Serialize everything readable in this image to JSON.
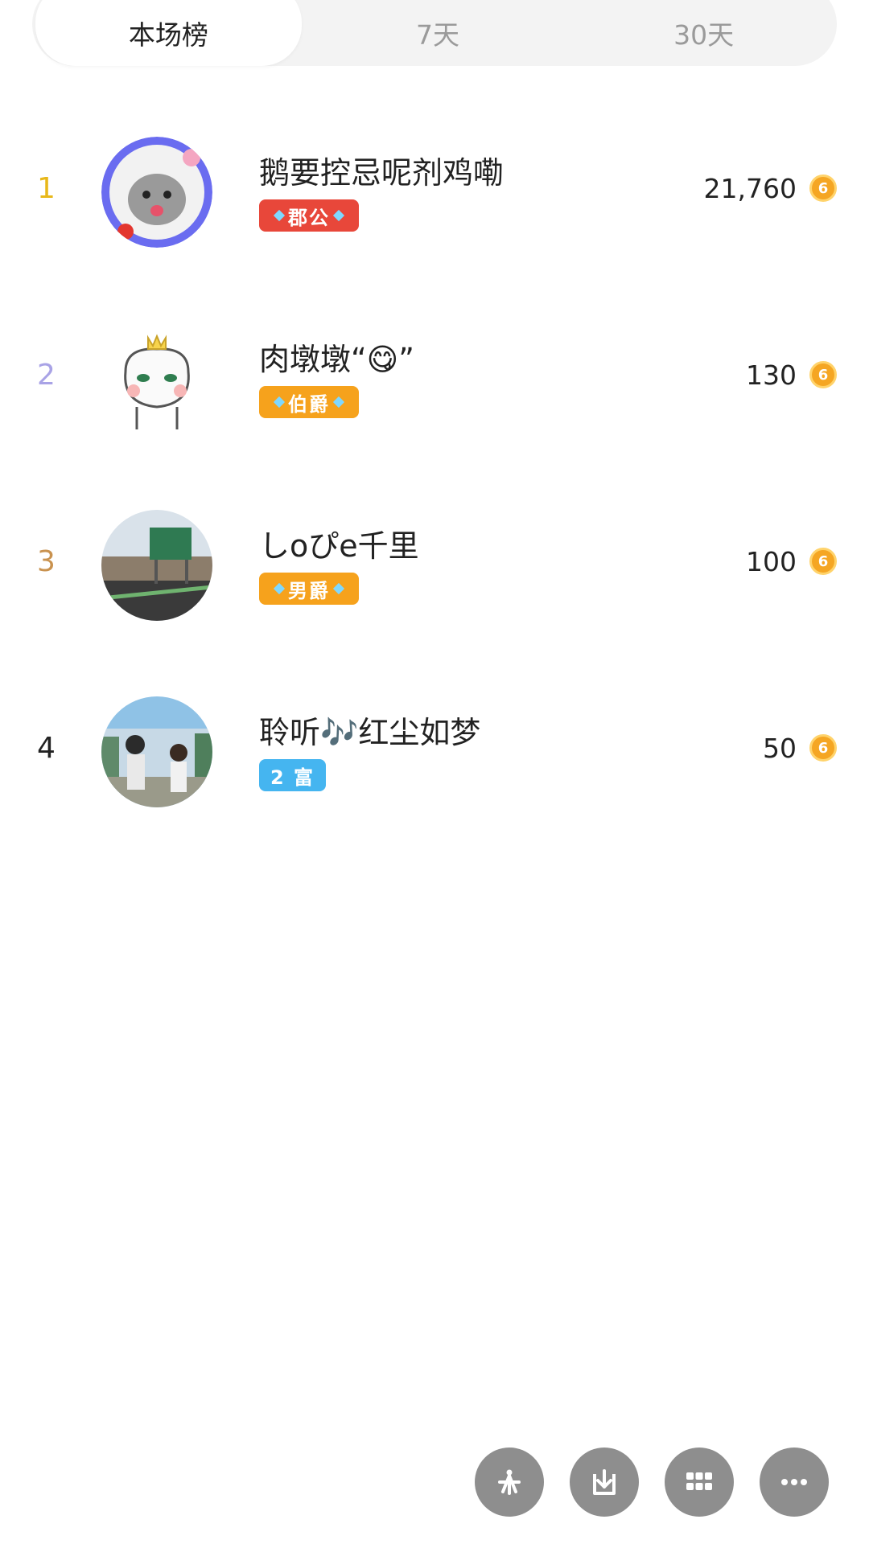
{
  "tabs": [
    {
      "label": "本场榜",
      "active": true
    },
    {
      "label": "7天",
      "active": false
    },
    {
      "label": "30天",
      "active": false
    }
  ],
  "rows": [
    {
      "rank": "1",
      "rank_color": "#e8b81a",
      "name": "鹅要控忌呢剂鸡嘞",
      "badge": "郡公",
      "badge_color": "#e8473a",
      "score": "21,760"
    },
    {
      "rank": "2",
      "rank_color": "#a9a3e6",
      "name": "肉墩墩“😋”",
      "badge": "伯爵",
      "badge_color": "#f6a21c",
      "score": "130"
    },
    {
      "rank": "3",
      "rank_color": "#c9924f",
      "name": "しoぴe千里",
      "badge": "男爵",
      "badge_color": "#f6a21c",
      "score": "100"
    },
    {
      "rank": "4",
      "rank_color": "#222222",
      "name": "聆听🎶红尘如梦",
      "badge": "2 富",
      "badge_color": "#45b5f0",
      "score": "50"
    }
  ],
  "coin_icon": "gold-coin-icon",
  "coin_glyph": "6",
  "actions": [
    {
      "name": "share-icon"
    },
    {
      "name": "download-icon"
    },
    {
      "name": "grid-icon"
    },
    {
      "name": "more-icon"
    }
  ]
}
